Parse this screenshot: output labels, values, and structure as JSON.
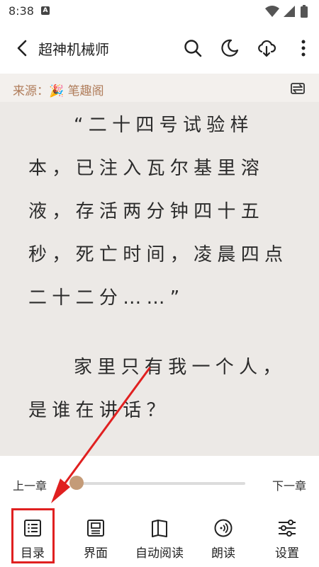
{
  "status_bar": {
    "time": "8:38",
    "notification_glyph": "A"
  },
  "header": {
    "title": "超神机械师",
    "icons": [
      "back-arrow",
      "search",
      "night-mode",
      "cloud-download",
      "more-vert"
    ]
  },
  "source": {
    "label": "来源：🎉 笔趣阁",
    "icon": "switch-source"
  },
  "content": {
    "paragraphs": [
      "“二十四号试验样本，已注入瓦尔基里溶液，存活两分钟四十五秒，死亡时间，凌晨四点二十二分……”",
      "家里只有我一个人，是谁在讲话？"
    ]
  },
  "progress": {
    "prev_label": "上一章",
    "next_label": "下一章",
    "value": 0.04
  },
  "bottom_nav": {
    "items": [
      {
        "label": "目录",
        "icon": "list"
      },
      {
        "label": "界面",
        "icon": "layout"
      },
      {
        "label": "自动阅读",
        "icon": "book-open"
      },
      {
        "label": "朗读",
        "icon": "read-aloud"
      },
      {
        "label": "设置",
        "icon": "sliders"
      }
    ]
  },
  "annotation": {
    "highlight_color": "#e02020",
    "highlighted_item": "目录"
  },
  "colors": {
    "accent": "#c49b78",
    "source_text": "#b07d5b",
    "reader_bg": "#ece9e6"
  }
}
